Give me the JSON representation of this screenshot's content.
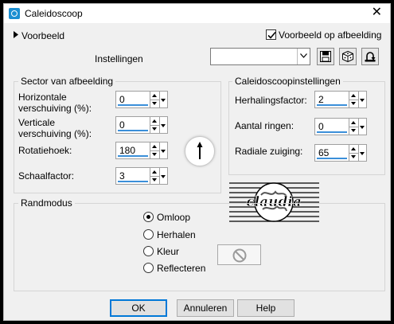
{
  "window": {
    "title": "Caleidoscoop"
  },
  "preview": {
    "toggle_label": "Voorbeeld",
    "checkbox_label": "Voorbeeld op afbeelding",
    "checked": true
  },
  "settings": {
    "label": "Instellingen",
    "value": ""
  },
  "sector": {
    "title": "Sector van afbeelding",
    "fields": [
      {
        "label_line1": "Horizontale",
        "label_line2": "verschuiving (%):",
        "value": "0"
      },
      {
        "label_line1": "Verticale",
        "label_line2": "verschuiving (%):",
        "value": "0"
      },
      {
        "label": "Rotatiehoek:",
        "value": "180"
      },
      {
        "label": "Schaalfactor:",
        "value": "3"
      }
    ]
  },
  "kaleido": {
    "title": "Caleidoscoopinstellingen",
    "fields": [
      {
        "label": "Herhalingsfactor:",
        "value": "2"
      },
      {
        "label": "Aantal ringen:",
        "value": "0"
      },
      {
        "label": "Radiale zuiging:",
        "value": "65"
      }
    ]
  },
  "watermark": {
    "text": "claudia"
  },
  "edge": {
    "title": "Randmodus",
    "options": [
      {
        "label": "Omloop",
        "selected": true
      },
      {
        "label": "Herhalen",
        "selected": false
      },
      {
        "label": "Kleur",
        "selected": false
      },
      {
        "label": "Reflecteren",
        "selected": false
      }
    ]
  },
  "buttons": {
    "ok": "OK",
    "cancel": "Annuleren",
    "help": "Help"
  },
  "colors": {
    "accent": "#3b8fd9",
    "default_border": "#0078d7",
    "title_icon": "#1b8fd2"
  }
}
